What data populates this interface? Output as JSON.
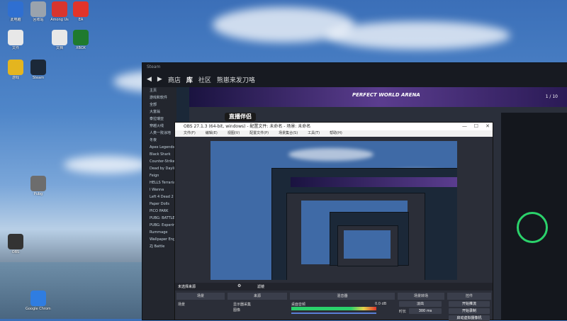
{
  "desktop": {
    "icons": [
      {
        "label": "此电脑",
        "color": "#2f6fd1"
      },
      {
        "label": "回收站",
        "color": "#9aa3ad"
      },
      {
        "label": "Among Us",
        "color": "#d8352e"
      },
      {
        "label": "EA",
        "color": "#e2342a"
      },
      {
        "label": "文件",
        "color": "#e8e8e8"
      },
      {
        "label": "XBOX",
        "color": "#1f7a2e"
      },
      {
        "label": "文档",
        "color": "#e8e8e8"
      },
      {
        "label": "Steam",
        "color": "#1b2838"
      },
      {
        "label": "游戏",
        "color": "#e4b51f"
      },
      {
        "label": "Google Chrome",
        "color": "#2f7de1"
      },
      {
        "label": "Pubg",
        "color": "#6d6d6d"
      },
      {
        "label": "OBS",
        "color": "#333"
      }
    ]
  },
  "steam": {
    "top": "Steam",
    "nav": [
      "商店",
      "库",
      "社区",
      "熊崽来发刀咯"
    ],
    "active_tab": "库",
    "banner_title": "PERFECT WORLD ARENA",
    "page_indicator": "1 / 10",
    "sidebar": [
      "主页",
      "游戏和软件",
      "全部",
      "大富翁",
      "泰拉瑞亚",
      "穿越火线",
      "人类一败涂地",
      "冬夜",
      "Apex Legends",
      "Black Shark",
      "Counter-Strike",
      "Dead by Daylight",
      "Feign",
      "HELLS Terraria",
      "I Wanna",
      "Left 4 Dead 2",
      "Paper Dolls",
      "PICO PARK",
      "PUBG: BATTLEGROUNDS",
      "PUBG: Experimental",
      "Rummage",
      "Wallpaper Engine",
      "ZJ Battle"
    ]
  },
  "obs": {
    "title": "OBS 27.1.3 (64-bit, windows) - 配置文件: 未命名 - 场景: 未命名",
    "menu": [
      "文件(F)",
      "编辑(E)",
      "视图(V)",
      "配置文件(P)",
      "场景集合(S)",
      "工具(T)",
      "帮助(H)"
    ],
    "banner": "直播伴侣",
    "scene_header": "场景",
    "scene_item": "场景",
    "source_header": "来源",
    "sources": [
      "显示器采集",
      "图像"
    ],
    "mixer_header": "混音器",
    "mixer_track": "桌面音频",
    "mixer_level": "0.0 dB",
    "transition_header": "场景转场",
    "transition_value": "淡出",
    "duration_label": "时长",
    "duration_value": "300 ms",
    "controls_header": "控件",
    "controls": [
      "开始推流",
      "开始录制",
      "启动虚拟摄像机"
    ],
    "filter_label": "滤镜",
    "source_bar": "未选择来源"
  }
}
